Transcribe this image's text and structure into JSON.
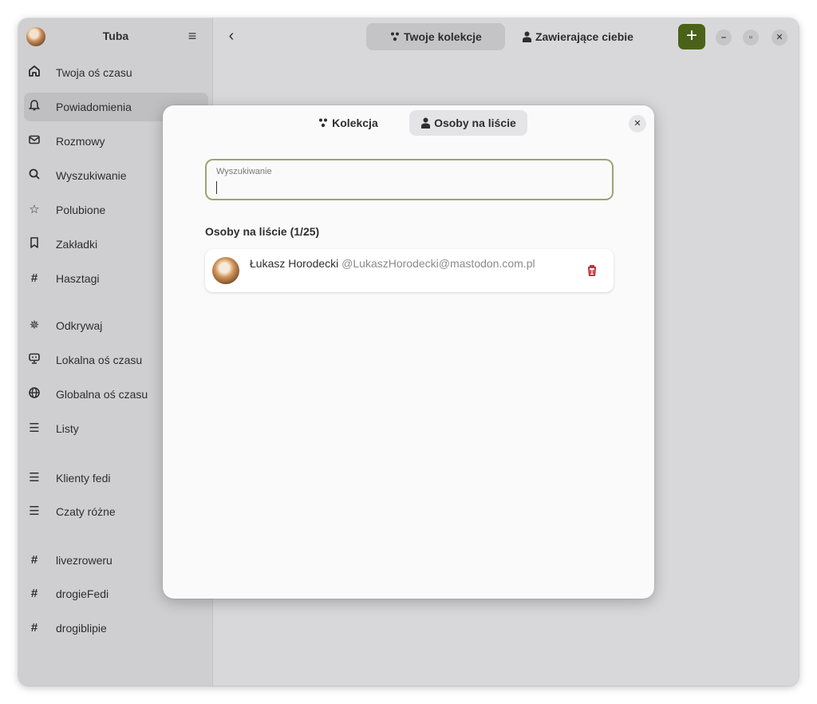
{
  "app": {
    "title": "Tuba"
  },
  "sidebar": {
    "items": [
      {
        "label": "Twoja oś czasu",
        "icon": "home-icon"
      },
      {
        "label": "Powiadomienia",
        "icon": "bell-icon"
      },
      {
        "label": "Rozmowy",
        "icon": "mail-icon"
      },
      {
        "label": "Wyszukiwanie",
        "icon": "search-icon"
      },
      {
        "label": "Polubione",
        "icon": "star-icon"
      },
      {
        "label": "Zakładki",
        "icon": "bookmark-icon"
      },
      {
        "label": "Hasztagi",
        "icon": "hashtag-icon"
      },
      {
        "label": "Odkrywaj",
        "icon": "explore-icon"
      },
      {
        "label": "Lokalna oś czasu",
        "icon": "local-icon"
      },
      {
        "label": "Globalna oś czasu",
        "icon": "globe-icon"
      },
      {
        "label": "Listy",
        "icon": "list-icon"
      },
      {
        "label": "Klienty fedi",
        "icon": "list-icon"
      },
      {
        "label": "Czaty różne",
        "icon": "list-icon"
      },
      {
        "label": "livezroweru",
        "icon": "hashtag-icon"
      },
      {
        "label": "drogieFedi",
        "icon": "hashtag-icon"
      },
      {
        "label": "drogiblipie",
        "icon": "hashtag-icon"
      }
    ]
  },
  "header": {
    "tabs": [
      {
        "label": "Twoje kolekcje",
        "icon": "collection-icon"
      },
      {
        "label": "Zawierające ciebie",
        "icon": "person-icon"
      }
    ]
  },
  "dialog": {
    "tabs": [
      {
        "label": "Kolekcja",
        "icon": "collection-icon"
      },
      {
        "label": "Osoby na liście",
        "icon": "person-icon"
      }
    ],
    "search": {
      "label": "Wyszukiwanie",
      "value": ""
    },
    "section_title": "Osoby na liście (1/25)",
    "people": [
      {
        "name": "Łukasz Horodecki",
        "handle": "@LukaszHorodecki@mastodon.com.pl"
      }
    ]
  },
  "colors": {
    "accent": "#4a6218",
    "danger": "#c01c28",
    "focus_ring": "#9ea36e"
  }
}
